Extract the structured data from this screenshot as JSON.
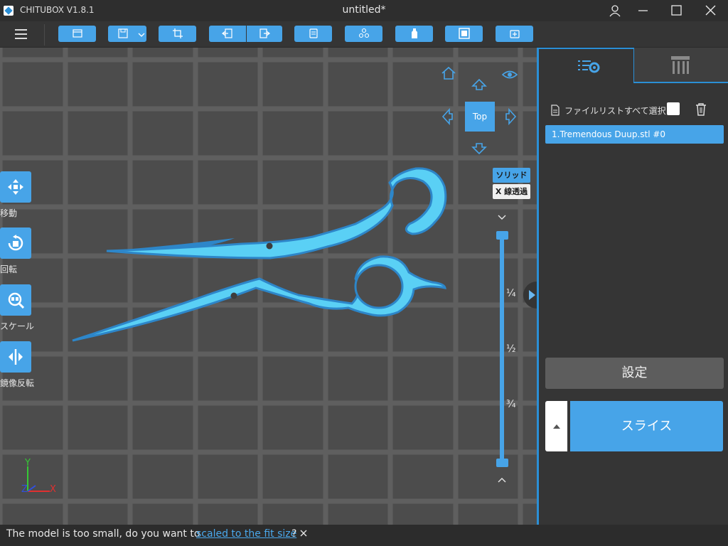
{
  "titlebar": {
    "app_name": "CHITUBOX V1.8.1",
    "doc_title": "untitled*",
    "icons": [
      "user-icon",
      "minimize-icon",
      "maximize-icon",
      "close-icon"
    ]
  },
  "toolbar": {
    "buttons": [
      "open-file-icon",
      "save-icon",
      "crop-icon",
      "import-icon",
      "export-icon",
      "copy-icon",
      "layout-icon",
      "liquid-icon",
      "hollow-icon",
      "drill-icon"
    ]
  },
  "viewport": {
    "side_tools": [
      {
        "label": "移動",
        "icon": "move-icon"
      },
      {
        "label": "回転",
        "icon": "rotate-icon"
      },
      {
        "label": "スケール",
        "icon": "scale-icon"
      },
      {
        "label": "鏡像反転",
        "icon": "mirror-icon"
      }
    ],
    "view_cube": {
      "top_label": "Top"
    },
    "render_modes": {
      "solid": "ソリッド",
      "xray": "X 線透過"
    },
    "layer_fractions": [
      "¼",
      "½",
      "¾"
    ],
    "axes": {
      "y": "Y",
      "z": "Z",
      "x": "X"
    }
  },
  "panel": {
    "tabs": [
      {
        "icon": "file-settings-icon"
      },
      {
        "icon": "supports-icon"
      }
    ],
    "select_all_label": "ファイルリストすべて選択",
    "select_all_checked": false,
    "files": [
      "1.Tremendous Duup.stl #0"
    ],
    "settings_label": "設定",
    "slice_label": "スライス"
  },
  "status": {
    "message": "The model is too small, do you want to",
    "link": "scaled to the fit size",
    "suffix": "?"
  },
  "colors": {
    "accent": "#47a4e8",
    "model_light": "#5ad0f5",
    "model_dark": "#2d86c9",
    "viewport_bg": "#4c4c4c",
    "panel_bg": "#353535"
  }
}
